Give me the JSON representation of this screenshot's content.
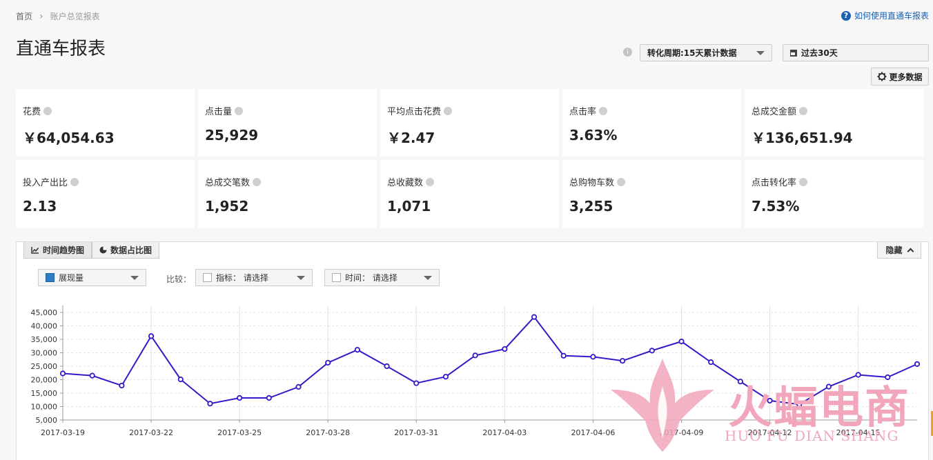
{
  "breadcrumb": {
    "home": "首页",
    "current": "账户总览报表"
  },
  "help_link": "如何使用直通车报表",
  "page_title": "直通车报表",
  "controls": {
    "cycle_label": "转化周期:15天累计数据",
    "period_label": "过去30天",
    "more_label": "更多数据"
  },
  "metrics": [
    {
      "label": "花费",
      "value": "￥64,054.63"
    },
    {
      "label": "点击量",
      "value": "25,929"
    },
    {
      "label": "平均点击花费",
      "value": "￥2.47"
    },
    {
      "label": "点击率",
      "value": "3.63%"
    },
    {
      "label": "总成交金额",
      "value": "￥136,651.94"
    },
    {
      "label": "投入产出比",
      "value": "2.13"
    },
    {
      "label": "总成交笔数",
      "value": "1,952"
    },
    {
      "label": "总收藏数",
      "value": "1,071"
    },
    {
      "label": "总购物车数",
      "value": "3,255"
    },
    {
      "label": "点击转化率",
      "value": "7.53%"
    }
  ],
  "chart_panel": {
    "tab_trend": "时间趋势图",
    "tab_share": "数据占比图",
    "hide_label": "隐藏",
    "metric_select": "展现量",
    "compare_label": "比较：",
    "index_select": "指标： 请选择",
    "time_select": "时间： 请选择"
  },
  "watermark": {
    "text": "火蝠电商",
    "sub": "HUO FU DIAN SHANG"
  },
  "colors": {
    "line": "#3318c9",
    "accent": "#1a5fb4",
    "watermark": "#f1a6bb"
  },
  "chart_data": {
    "type": "line",
    "x": [
      "2017-03-19",
      "2017-03-20",
      "2017-03-21",
      "2017-03-22",
      "2017-03-23",
      "2017-03-24",
      "2017-03-25",
      "2017-03-26",
      "2017-03-27",
      "2017-03-28",
      "2017-03-29",
      "2017-03-30",
      "2017-03-31",
      "2017-04-01",
      "2017-04-02",
      "2017-04-03",
      "2017-04-04",
      "2017-04-05",
      "2017-04-06",
      "2017-04-07",
      "2017-04-08",
      "2017-04-09",
      "2017-04-10",
      "2017-04-11",
      "2017-04-12",
      "2017-04-13",
      "2017-04-14",
      "2017-04-15",
      "2017-04-16",
      "2017-04-17"
    ],
    "tick_labels": [
      "2017-03-19",
      "2017-03-22",
      "2017-03-25",
      "2017-03-28",
      "2017-03-31",
      "2017-04-03",
      "2017-04-06",
      "2017-04-09",
      "2017-04-12",
      "2017-04-15"
    ],
    "series": [
      {
        "values": [
          22300,
          21500,
          17800,
          36200,
          20100,
          11100,
          13200,
          13200,
          17300,
          26300,
          31100,
          25000,
          18700,
          21100,
          29000,
          31400,
          43300,
          28900,
          28500,
          27000,
          30800,
          34200,
          26500,
          19300,
          12200,
          10800,
          17400,
          21800,
          20900,
          25800
        ]
      }
    ],
    "yticks": [
      5000,
      10000,
      15000,
      20000,
      25000,
      30000,
      35000,
      40000,
      45000
    ],
    "ytick_labels": [
      "5,000",
      "10,000",
      "15,000",
      "20,000",
      "25,000",
      "30,000",
      "35,000",
      "40,000",
      "45,000"
    ],
    "ylim": [
      5000,
      45000
    ],
    "grid": true,
    "legend": "none"
  }
}
